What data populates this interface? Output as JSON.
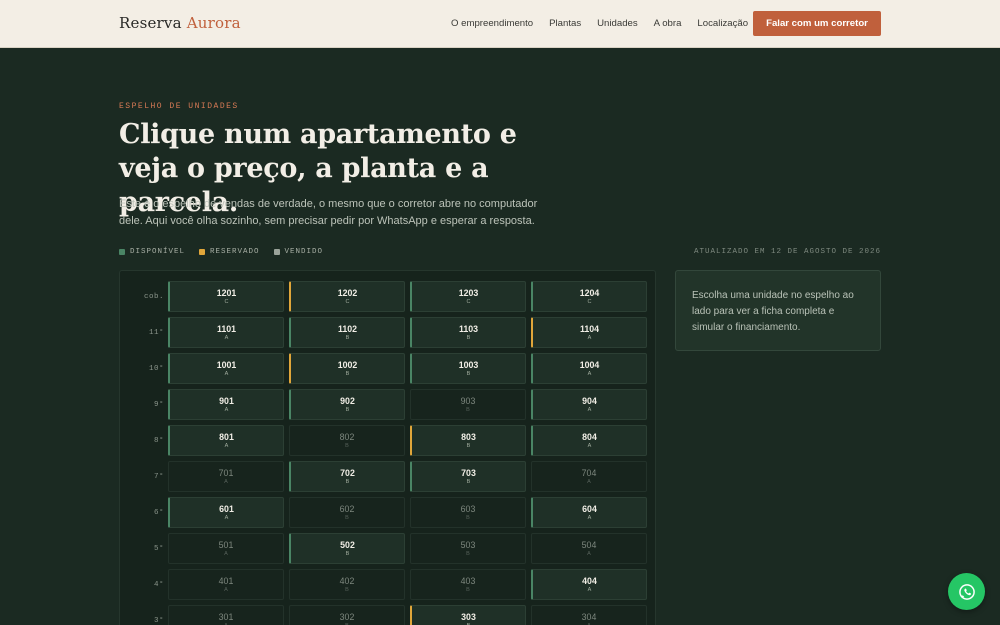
{
  "header": {
    "logo_main": "Reserva",
    "logo_accent": "Aurora",
    "nav": [
      "O empreendimento",
      "Plantas",
      "Unidades",
      "A obra",
      "Localização"
    ],
    "cta": "Falar com um corretor"
  },
  "hero": {
    "eyebrow": "ESPELHO DE UNIDADES",
    "headline": "Clique num apartamento e veja o preço, a planta e a parcela.",
    "lede": "Este é o espelho de vendas de verdade, o mesmo que o corretor abre no computador dele. Aqui você olha sozinho, sem precisar pedir por WhatsApp e esperar a resposta."
  },
  "legend": {
    "available": "DISPONÍVEL",
    "reserved": "RESERVADO",
    "sold": "VENDIDO",
    "updated": "ATUALIZADO EM 12 DE AGOSTO DE 2026"
  },
  "colors": {
    "available": "#4a8565",
    "reserved": "#e0a63a",
    "sold": "#9aa39a",
    "brand_accent": "#c0603c",
    "whatsapp": "#25c665"
  },
  "floors": [
    {
      "label": "cob.",
      "units": [
        {
          "n": "1201",
          "t": "C",
          "s": "avail"
        },
        {
          "n": "1202",
          "t": "C",
          "s": "reserved"
        },
        {
          "n": "1203",
          "t": "C",
          "s": "avail"
        },
        {
          "n": "1204",
          "t": "C",
          "s": "avail"
        }
      ]
    },
    {
      "label": "11°",
      "units": [
        {
          "n": "1101",
          "t": "A",
          "s": "avail"
        },
        {
          "n": "1102",
          "t": "B",
          "s": "avail"
        },
        {
          "n": "1103",
          "t": "B",
          "s": "avail"
        },
        {
          "n": "1104",
          "t": "A",
          "s": "reserved"
        }
      ]
    },
    {
      "label": "10°",
      "units": [
        {
          "n": "1001",
          "t": "A",
          "s": "avail"
        },
        {
          "n": "1002",
          "t": "B",
          "s": "reserved"
        },
        {
          "n": "1003",
          "t": "B",
          "s": "avail"
        },
        {
          "n": "1004",
          "t": "A",
          "s": "avail"
        }
      ]
    },
    {
      "label": "9°",
      "units": [
        {
          "n": "901",
          "t": "A",
          "s": "avail"
        },
        {
          "n": "902",
          "t": "B",
          "s": "avail"
        },
        {
          "n": "903",
          "t": "B",
          "s": "sold"
        },
        {
          "n": "904",
          "t": "A",
          "s": "avail"
        }
      ]
    },
    {
      "label": "8°",
      "units": [
        {
          "n": "801",
          "t": "A",
          "s": "avail"
        },
        {
          "n": "802",
          "t": "B",
          "s": "sold"
        },
        {
          "n": "803",
          "t": "B",
          "s": "reserved"
        },
        {
          "n": "804",
          "t": "A",
          "s": "avail"
        }
      ]
    },
    {
      "label": "7°",
      "units": [
        {
          "n": "701",
          "t": "A",
          "s": "sold"
        },
        {
          "n": "702",
          "t": "B",
          "s": "avail"
        },
        {
          "n": "703",
          "t": "B",
          "s": "avail"
        },
        {
          "n": "704",
          "t": "A",
          "s": "sold"
        }
      ]
    },
    {
      "label": "6°",
      "units": [
        {
          "n": "601",
          "t": "A",
          "s": "avail"
        },
        {
          "n": "602",
          "t": "B",
          "s": "sold"
        },
        {
          "n": "603",
          "t": "B",
          "s": "sold"
        },
        {
          "n": "604",
          "t": "A",
          "s": "avail"
        }
      ]
    },
    {
      "label": "5°",
      "units": [
        {
          "n": "501",
          "t": "A",
          "s": "sold"
        },
        {
          "n": "502",
          "t": "B",
          "s": "avail"
        },
        {
          "n": "503",
          "t": "B",
          "s": "sold"
        },
        {
          "n": "504",
          "t": "A",
          "s": "sold"
        }
      ]
    },
    {
      "label": "4°",
      "units": [
        {
          "n": "401",
          "t": "A",
          "s": "sold"
        },
        {
          "n": "402",
          "t": "B",
          "s": "sold"
        },
        {
          "n": "403",
          "t": "B",
          "s": "sold"
        },
        {
          "n": "404",
          "t": "A",
          "s": "avail"
        }
      ]
    },
    {
      "label": "3°",
      "units": [
        {
          "n": "301",
          "t": "A",
          "s": "sold"
        },
        {
          "n": "302",
          "t": "B",
          "s": "sold"
        },
        {
          "n": "303",
          "t": "B",
          "s": "reserved"
        },
        {
          "n": "304",
          "t": "A",
          "s": "sold"
        }
      ]
    }
  ],
  "info_card": "Escolha uma unidade no espelho ao lado para ver a ficha completa e simular o financiamento.",
  "whatsapp_icon": "whatsapp-icon"
}
